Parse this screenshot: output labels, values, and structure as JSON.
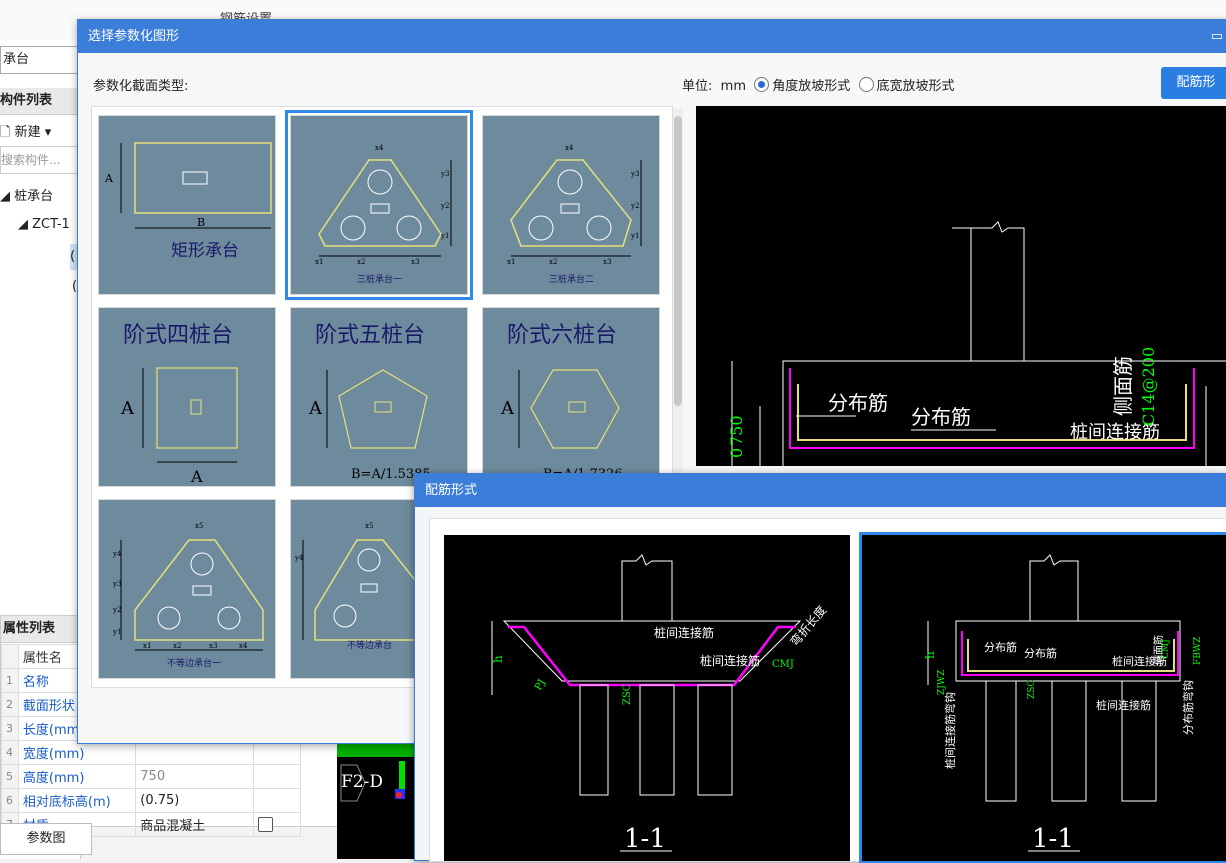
{
  "background": {
    "top_fragment": "钢筋设置",
    "component_name": "承台",
    "component_tab": "构件列表",
    "new_button": "新建",
    "search_placeholder": "搜索构件...",
    "tree_root": "桩承台",
    "tree_child": "ZCT-1",
    "props_tab": "属性列表",
    "props_header": "属性名",
    "props": [
      {
        "n": "1",
        "key": "名称",
        "value": ""
      },
      {
        "n": "2",
        "key": "截面形状",
        "value": ""
      },
      {
        "n": "3",
        "key": "长度(mm)",
        "value": ""
      },
      {
        "n": "4",
        "key": "宽度(mm)",
        "value": ""
      },
      {
        "n": "5",
        "key": "高度(mm)",
        "value": "750"
      },
      {
        "n": "6",
        "key": "相对底标高(m)",
        "value": "(0.75)"
      },
      {
        "n": "7",
        "key": "材质",
        "value": "商品混凝土"
      }
    ],
    "param_button": "参数图",
    "cad_label": "F2-D"
  },
  "dialog1": {
    "title": "选择参数化图形",
    "type_label": "参数化截面类型:",
    "unit_label": "单位:",
    "unit_value": "mm",
    "radio_angle": "角度放坡形式",
    "radio_bottom": "底宽放坡形式",
    "config_button": "配筋形",
    "tiles": [
      {
        "caption": "矩形承台",
        "dims": [
          "A",
          "B"
        ]
      },
      {
        "caption": "三桩承台一",
        "dims": [
          "x4",
          "y3",
          "y2",
          "y1",
          "x1",
          "x2",
          "x3"
        ]
      },
      {
        "caption": "三桩承台二",
        "dims": [
          "x4",
          "y3",
          "y2",
          "y1",
          "x1",
          "x2",
          "x3"
        ]
      },
      {
        "caption": "阶式四桩台",
        "dims": [
          "A",
          "A"
        ]
      },
      {
        "caption": "阶式五桩台",
        "dims": [
          "A",
          "B=A/1.5385"
        ]
      },
      {
        "caption": "阶式六桩台",
        "dims": [
          "A",
          "B=A/1.7326"
        ]
      },
      {
        "caption": "不等边承台一",
        "dims": [
          "x5",
          "y4",
          "y3",
          "y2",
          "y1",
          "x1",
          "x2",
          "x3",
          "x4"
        ]
      },
      {
        "caption": "不等边承台",
        "dims": [
          "x5",
          "y4"
        ]
      }
    ],
    "preview": {
      "labels": [
        "分布筋",
        "分布筋",
        "桩间连接筋",
        "侧面筋"
      ],
      "green": [
        "C14@200",
        "750",
        "0"
      ]
    }
  },
  "dialog2": {
    "title": "配筋形式",
    "option_a": {
      "labels": [
        "桩间连接筋",
        "桩间连接筋",
        "弯折长度"
      ],
      "green": [
        "CMJ",
        "ZSC",
        "PJ"
      ],
      "section": "1-1",
      "dim": "h"
    },
    "option_b": {
      "labels": [
        "分布筋",
        "分布筋",
        "侧面筋",
        "桩间连接筋",
        "桩间连接筋",
        "桩间连接筋弯钩",
        "分布筋弯钩"
      ],
      "green": [
        "ZJWZ",
        "CMJ",
        "ZSC",
        "FBWZ"
      ],
      "section": "1-1",
      "dim": "h"
    }
  },
  "colors": {
    "title_bar": "#3b7ed9",
    "selection": "#2d8ae8",
    "tile_bg": "#6e8b9d",
    "shape_line": "#e5e07a",
    "rebar": "#ff00ff",
    "dim_green": "#00ff00"
  }
}
